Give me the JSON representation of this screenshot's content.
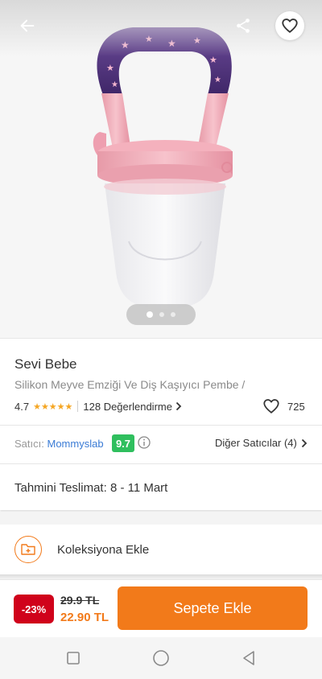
{
  "product": {
    "brand": "Sevi Bebe",
    "name": "Silikon Meyve Emziği Ve Diş Kaşıyıcı Pembe /",
    "rating": "4.7",
    "stars": "★★★★★",
    "reviews_label": "128 Değerlendirme",
    "favorite_count": "725",
    "image_count": 3,
    "image_index": 1
  },
  "seller": {
    "label": "Satıcı:",
    "name": "Mommyslab",
    "score": "9.7",
    "other_sellers": "Diğer Satıcılar (4)"
  },
  "delivery": {
    "label": "Tahmini Teslimat:",
    "dates": "8 - 11 Mart"
  },
  "collection": {
    "label": "Koleksiyona Ekle"
  },
  "buy": {
    "discount": "-23%",
    "old_price": "29.9 TL",
    "new_price": "22.90 TL",
    "add_to_cart": "Sepete Ekle"
  },
  "icons": {
    "back": "arrow-left-icon",
    "share": "share-icon",
    "favorite": "heart-icon",
    "info": "info-icon",
    "collection": "folder-plus-icon"
  },
  "colors": {
    "accent": "#f27a1a",
    "discount_bg": "#d0021b",
    "seller_link": "#3a7bd5",
    "score_bg": "#2fbf5e",
    "stars": "#f5a623"
  }
}
